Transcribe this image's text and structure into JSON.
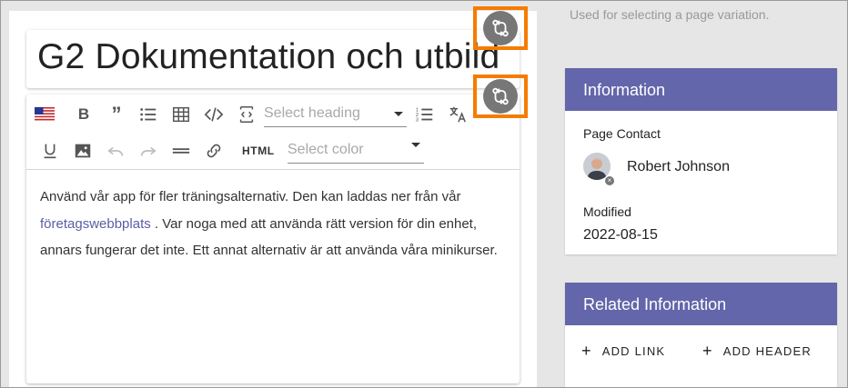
{
  "title": "G2 Dokumentation och utbild",
  "toolbar": {
    "flag_icon": "us-flag-icon",
    "heading_placeholder": "Select heading",
    "color_placeholder": "Select color",
    "html_label": "HTML"
  },
  "content": {
    "text_before_link": "Använd vår app för fler träningsalternativ. Den kan laddas ner från vår",
    "link_text": "företagswebbplats",
    "text_after_link": " . Var noga med att använda rätt version för din enhet, annars fungerar det inte. Ett annat alternativ är att använda våra minikurser."
  },
  "sidebar": {
    "hint": "Used for selecting a page variation.",
    "information": {
      "header": "Information",
      "page_contact_label": "Page Contact",
      "contact_name": "Robert Johnson",
      "modified_label": "Modified",
      "modified_value": "2022-08-15"
    },
    "related": {
      "header": "Related Information",
      "add_link": "ADD LINK",
      "add_header": "ADD HEADER"
    }
  },
  "colors": {
    "accent_header": "#6366aa",
    "highlight_border": "#f57c00",
    "link": "#5a5ea6"
  }
}
